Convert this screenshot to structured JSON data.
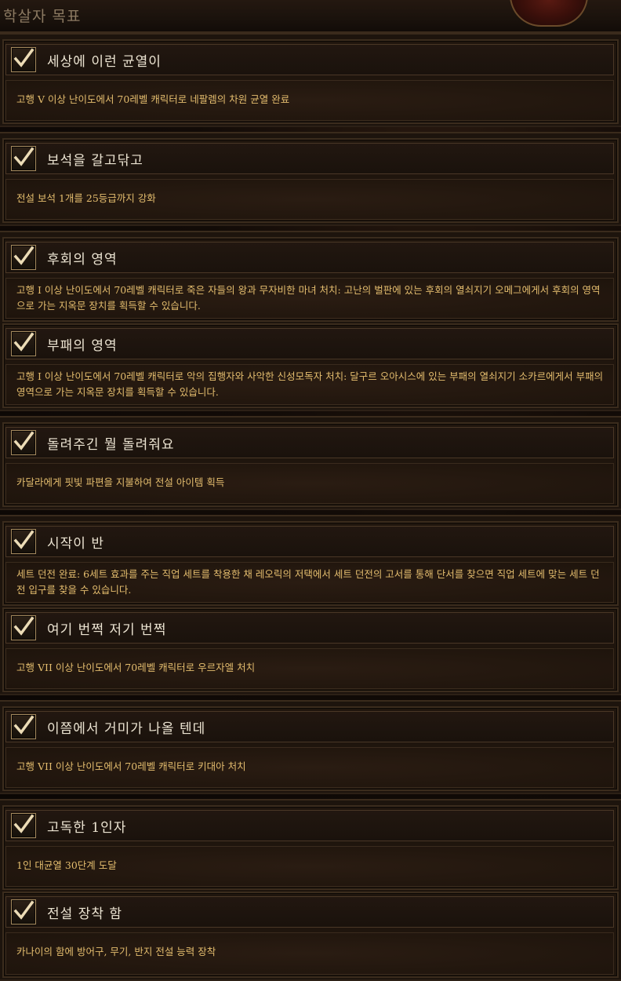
{
  "header": {
    "title": "학살자 목표"
  },
  "groups": [
    {
      "achievements": [
        {
          "title": "세상에 이런 균열이",
          "description": "고행 V 이상 난이도에서 70레벨 캐릭터로 네팔렘의 차원 균열 완료"
        }
      ]
    },
    {
      "achievements": [
        {
          "title": "보석을 갈고닦고",
          "description": "전설 보석 1개를 25등급까지 강화"
        }
      ]
    },
    {
      "achievements": [
        {
          "title": "후회의 영역",
          "description": "고행 I 이상 난이도에서 70레벨 캐릭터로 죽은 자들의 왕과 무자비한 마녀 처치: 고난의 벌판에 있는 후회의 열쇠지기 오메그에게서 후회의 영역으로 가는 지옥문 장치를 획득할 수 있습니다."
        },
        {
          "title": "부패의 영역",
          "description": "고행 I 이상 난이도에서 70레벨 캐릭터로 악의 집행자와 사악한 신성모독자 처치: 달구르 오아시스에 있는 부패의 열쇠지기 소카르에게서 부패의 영역으로 가는 지옥문 장치를 획득할 수 있습니다."
        }
      ]
    },
    {
      "achievements": [
        {
          "title": "돌려주긴 뭘 돌려줘요",
          "description": "카달라에게 핏빛 파편을 지불하여 전설 아이템 획득"
        }
      ]
    },
    {
      "achievements": [
        {
          "title": "시작이 반",
          "description": "세트 던전 완료: 6세트 효과를 주는 직업 세트를 착용한 채 레오릭의 저택에서 세트 던전의 고서를 통해 단서를 찾으면 직업 세트에 맞는 세트 던전 입구를 찾을 수 있습니다."
        },
        {
          "title": "여기 번쩍 저기 번쩍",
          "description": "고행 VII 이상 난이도에서 70레벨 캐릭터로 우르자엘 처치"
        }
      ]
    },
    {
      "achievements": [
        {
          "title": "이쯤에서 거미가 나올 텐데",
          "description": "고행 VII 이상 난이도에서 70레벨 캐릭터로 키대아 처치"
        }
      ]
    },
    {
      "achievements": [
        {
          "title": "고독한 1인자",
          "description": "1인 대균열 30단계 도달"
        },
        {
          "title": "전설 장착 함",
          "description": "카나이의 함에 방어구, 무기, 반지 전설 능력 장착"
        }
      ]
    }
  ]
}
